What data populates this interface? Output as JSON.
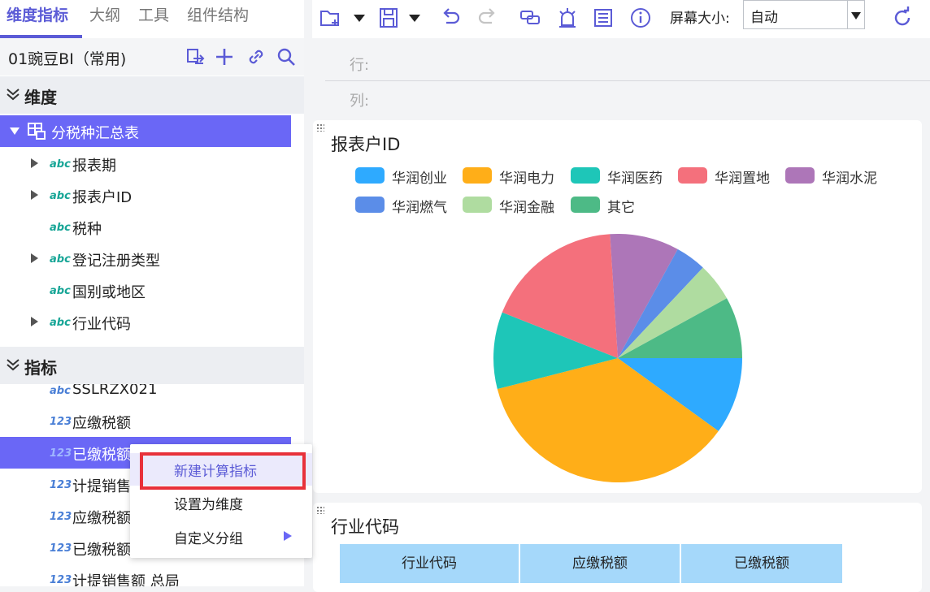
{
  "tabs": [
    {
      "label": "维度指标"
    },
    {
      "label": "大纲"
    },
    {
      "label": "工具"
    },
    {
      "label": "组件结构"
    }
  ],
  "package": {
    "name": "01豌豆BI（常用)"
  },
  "dimensions": {
    "title": "维度",
    "table_name": "分税种汇总表",
    "fields": [
      {
        "label": "报表期",
        "type": "abc",
        "expandable": true
      },
      {
        "label": "报表户ID",
        "type": "abc",
        "expandable": true
      },
      {
        "label": "税种",
        "type": "abc",
        "expandable": false
      },
      {
        "label": "登记注册类型",
        "type": "abc",
        "expandable": true
      },
      {
        "label": "国别或地区",
        "type": "abc",
        "expandable": false
      },
      {
        "label": "行业代码",
        "type": "abc",
        "expandable": true
      }
    ]
  },
  "measures": {
    "title": "指标",
    "fields": [
      {
        "label": "SSLRZX021",
        "type": "abc"
      },
      {
        "label": "应缴税额",
        "type": "123"
      },
      {
        "label": "已缴税额",
        "type": "123"
      },
      {
        "label": "计提销售",
        "type": "123"
      },
      {
        "label": "应缴税额",
        "type": "123"
      },
      {
        "label": "已缴税额",
        "type": "123"
      },
      {
        "label": "计提销售额 总局",
        "type": "123"
      }
    ]
  },
  "type_glyphs": {
    "abc": "abc",
    "123": "123"
  },
  "toolbar": {
    "screen_size_label": "屏幕大小:",
    "screen_size_value": "自动",
    "icons": [
      "new-page-icon",
      "dropdown-icon",
      "save-icon",
      "dropdown-icon",
      "undo-icon",
      "redo-icon",
      "link-icon",
      "alert-icon",
      "list-icon",
      "info-icon",
      "refresh-icon"
    ]
  },
  "shelves": {
    "row_label": "行:",
    "col_label": "列:"
  },
  "pie_card": {
    "title": "报表户ID"
  },
  "chart_data": {
    "type": "pie",
    "title": "报表户ID",
    "legend_position": "top",
    "series": [
      {
        "name": "华润创业",
        "value": 10,
        "color": "#2eaaff"
      },
      {
        "name": "华润电力",
        "value": 36,
        "color": "#ffae18"
      },
      {
        "name": "华润医药",
        "value": 10,
        "color": "#1ec6b8"
      },
      {
        "name": "华润置地",
        "value": 18,
        "color": "#f4707c"
      },
      {
        "name": "华润水泥",
        "value": 9,
        "color": "#ad76b8"
      },
      {
        "name": "华润燃气",
        "value": 4,
        "color": "#5b8de8"
      },
      {
        "name": "华润金融",
        "value": 5,
        "color": "#afdca0"
      },
      {
        "name": "其它",
        "value": 8,
        "color": "#4dba86"
      }
    ]
  },
  "table_card": {
    "title": "行业代码",
    "columns": [
      "行业代码",
      "应缴税额",
      "已缴税额"
    ]
  },
  "context_menu": {
    "items": [
      {
        "label": "新建计算指标"
      },
      {
        "label": "设置为维度"
      },
      {
        "label": "自定义分组"
      }
    ]
  },
  "colors": {
    "accent": "#6a67f6",
    "highlight_box": "#e8313a"
  }
}
